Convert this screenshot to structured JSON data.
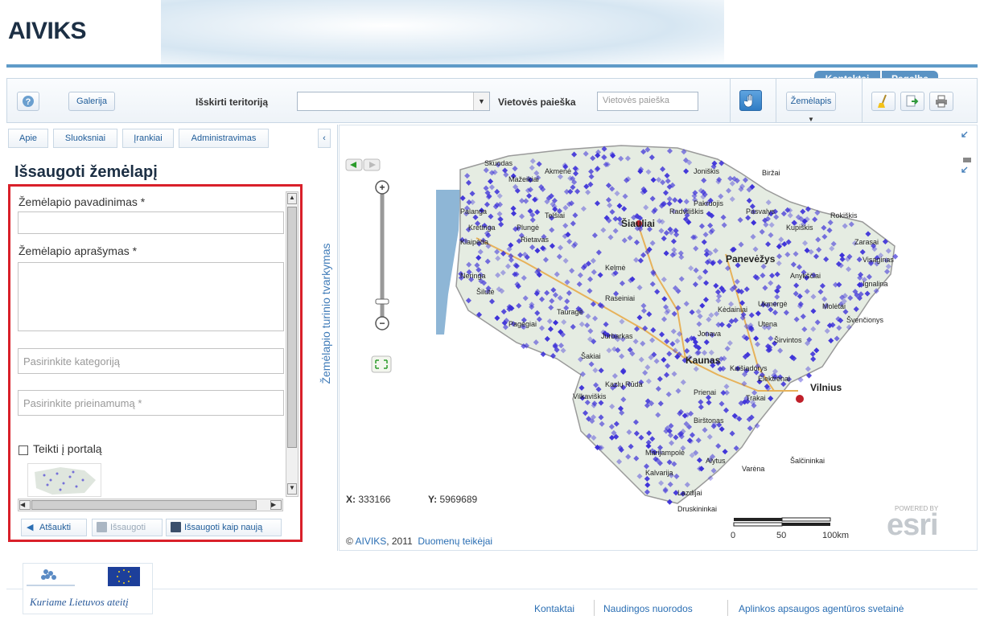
{
  "header": {
    "logo": "AIVIKS",
    "tabs": [
      "Kontaktai",
      "Pagalba"
    ]
  },
  "toolbar": {
    "help_icon": "help-icon",
    "gallery_label": "Galerija",
    "territory_label": "Išskirti teritoriją",
    "territory_value": "",
    "search_label": "Vietovės paieška",
    "search_placeholder": "Vietovės paieška",
    "basemap_label": "Žemėlapis"
  },
  "left_panel": {
    "tabs": [
      "Apie",
      "Sluoksniai",
      "Įrankiai",
      "Administravimas"
    ],
    "title": "Išsaugoti žemėlapį",
    "map_name_label": "Žemėlapio pavadinimas *",
    "map_name_value": "",
    "map_desc_label": "Žemėlapio aprašymas *",
    "map_desc_value": "",
    "category_placeholder": "Pasirinkite kategoriją",
    "access_placeholder": "Pasirinkite prieinamumą *",
    "portal_checkbox_label": "Teikti į portalą",
    "portal_checked": false,
    "buttons": {
      "cancel": "Atšaukti",
      "save": "Išsaugoti",
      "save_as_new": "Išsaugoti kaip naują"
    }
  },
  "vertical_strip": {
    "label": "Žemėlapio turinio tvarkymas"
  },
  "map": {
    "coords": {
      "x_label": "X:",
      "x_value": "333166",
      "y_label": "Y:",
      "y_value": "5969689"
    },
    "scale": {
      "labels": [
        "0",
        "50",
        "100km"
      ]
    },
    "copyright_prefix": "©",
    "copyright_link": "AIVIKS",
    "copyright_suffix": ", 2011",
    "providers_link": "Duomenų teikėjai",
    "powered_by": "POWERED BY",
    "esri": "esri",
    "cities": [
      "Šiauliai",
      "Panevėžys",
      "Kaunas",
      "Vilnius",
      "Klaipėda",
      "Telšiai",
      "Utena",
      "Alytus",
      "Marijampolė",
      "Tauragė",
      "Kupiškis",
      "Rokiškis",
      "Zarasai",
      "Visaginas",
      "Joniškis",
      "Biržai",
      "Kelmė",
      "Raseiniai",
      "Jurbarkas",
      "Jonava",
      "Kėdainiai",
      "Ukmergė",
      "Molėtai",
      "Švenčionys",
      "Širvintos",
      "Elektrėnai",
      "Trakai",
      "Prienai",
      "Birštonas",
      "Kalvarija",
      "Lazdijai",
      "Varėna",
      "Šalčininkai",
      "Druskininkai",
      "Vilkaviškis",
      "Kazlų Rūda",
      "Šakiai",
      "Neringa",
      "Šilutė",
      "Pagėgiai",
      "Plungė",
      "Kretinga",
      "Palanga",
      "Radviliškis",
      "Pakruojis",
      "Anykščiai",
      "Akmenė",
      "Mažeikiai",
      "Skuodas",
      "Rietavas",
      "Kaišiadorys",
      "Pasvalys",
      "Ignalina"
    ],
    "colors": {
      "marker": "#3b2fd8",
      "land": "#e5ece2",
      "border": "#9a9a9a"
    }
  },
  "footer": {
    "logo_text": "Kuriame Lietuvos ateitį",
    "links": [
      "Kontaktai",
      "Naudingos nuorodos",
      "Aplinkos apsaugos agentūros svetainė"
    ]
  }
}
